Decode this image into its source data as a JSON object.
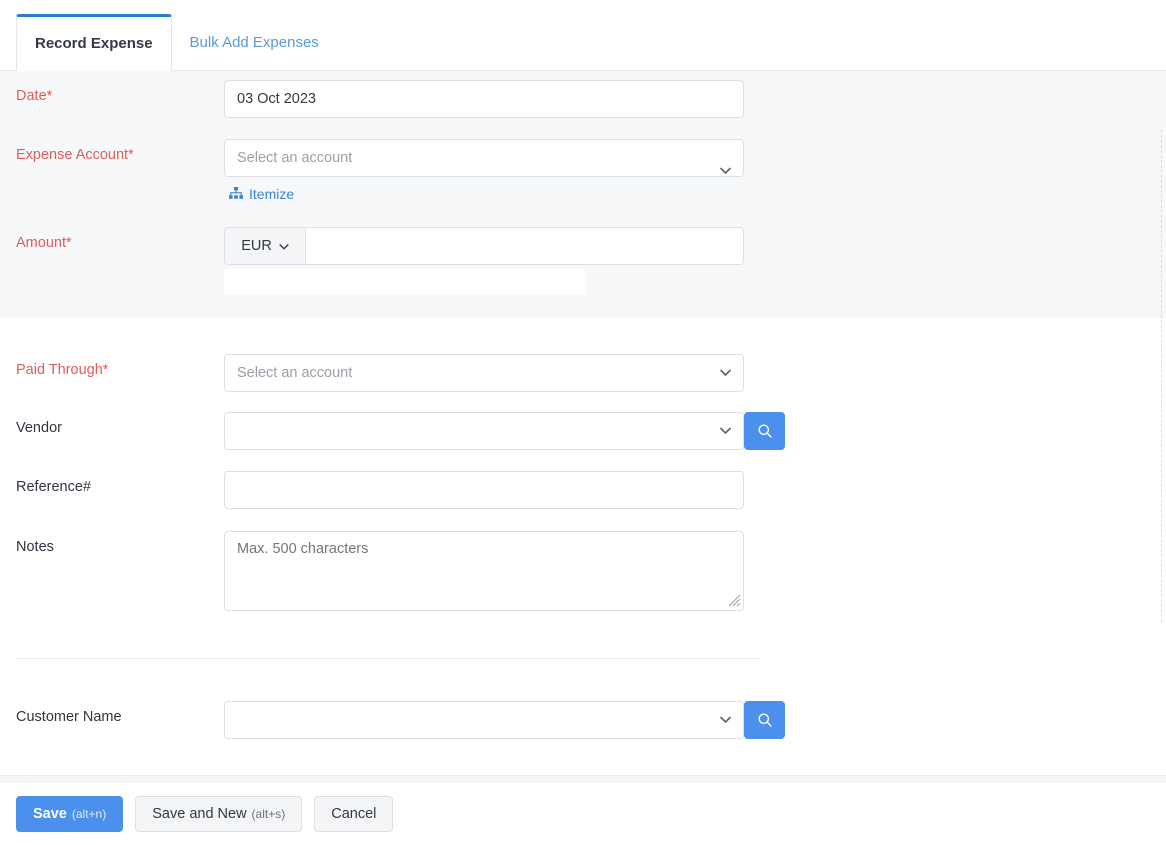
{
  "tabs": [
    {
      "label": "Record Expense",
      "active": true
    },
    {
      "label": "Bulk Add Expenses",
      "active": false
    }
  ],
  "form": {
    "date": {
      "label": "Date*",
      "value": "03 Oct 2023"
    },
    "expense_account": {
      "label": "Expense Account*",
      "placeholder": "Select an account",
      "value": "",
      "itemize_label": "Itemize",
      "itemize_icon": "sitemap-icon"
    },
    "amount": {
      "label": "Amount*",
      "currency": "EUR",
      "value": "",
      "placeholder": ""
    },
    "paid_through": {
      "label": "Paid Through*",
      "placeholder": "Select an account",
      "value": ""
    },
    "vendor": {
      "label": "Vendor",
      "value": "",
      "placeholder": "",
      "search_icon": "search-icon"
    },
    "reference": {
      "label": "Reference#",
      "value": "",
      "placeholder": ""
    },
    "notes": {
      "label": "Notes",
      "placeholder": "Max. 500 characters",
      "value": ""
    },
    "customer_name": {
      "label": "Customer Name",
      "value": "",
      "placeholder": "",
      "search_icon": "search-icon"
    }
  },
  "footer": {
    "save": {
      "label": "Save",
      "hint": "(alt+n)"
    },
    "save_and_new": {
      "label": "Save and New",
      "hint": "(alt+s)"
    },
    "cancel": {
      "label": "Cancel"
    }
  },
  "colors": {
    "accent_blue": "#4a90ec",
    "tab_active_border": "#2b7cd3",
    "link_blue": "#3b82d6",
    "required_red": "#e05c5c",
    "section_gray": "#f7f8fa",
    "field_border": "#dcdfe4"
  }
}
